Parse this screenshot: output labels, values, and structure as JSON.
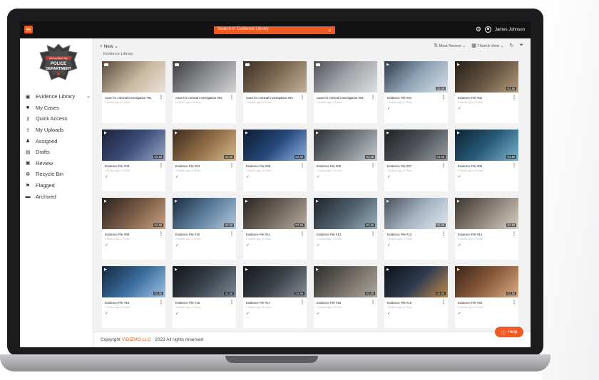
{
  "topbar": {
    "search_placeholder": "Search in Evidence Library",
    "user_name": "James Johnson"
  },
  "logo": {
    "badge_text": "Metropolitan City",
    "line1": "POLICE",
    "line2": "DEPARTMENT"
  },
  "sidebar": {
    "items": [
      {
        "label": "Evidence Library",
        "icon": "archive-icon"
      },
      {
        "label": "My Cases",
        "icon": "briefcase-icon"
      },
      {
        "label": "Quick Access",
        "icon": "key-icon"
      },
      {
        "label": "My Uploads",
        "icon": "upload-icon"
      },
      {
        "label": "Assigned",
        "icon": "assigned-user-icon"
      },
      {
        "label": "Drafts",
        "icon": "drafts-icon"
      },
      {
        "label": "Review",
        "icon": "review-icon"
      },
      {
        "label": "Recycle Bin",
        "icon": "recycle-icon"
      },
      {
        "label": "Flagged",
        "icon": "flag-icon"
      },
      {
        "label": "Archived",
        "icon": "archived-icon"
      }
    ]
  },
  "toolbar": {
    "new_label": "+ New ⌄",
    "sort_label": "Most Recent ⌄",
    "view_label": "Thumb View ⌄",
    "breadcrumb": "Evidence Library"
  },
  "cards": [
    {
      "title": "Case for criminal investigation #01",
      "sub": "1 Months ago | 0 Views",
      "duration": "",
      "kind": "case",
      "check": false
    },
    {
      "title": "Case for criminal investigation #02",
      "sub": "1 Months ago | 0 Views",
      "duration": "",
      "kind": "case",
      "check": false
    },
    {
      "title": "Case for criminal investigation #03",
      "sub": "1 Months ago | 0 Views",
      "duration": "",
      "kind": "case",
      "check": false
    },
    {
      "title": "Case for criminal investigation #04",
      "sub": "1 Months ago | 0 Views",
      "duration": "",
      "kind": "case",
      "check": false
    },
    {
      "title": "Evidence File #01",
      "sub": "1 Months ago | 0 Views",
      "duration": "01:49",
      "kind": "video",
      "check": true
    },
    {
      "title": "Evidence File #02",
      "sub": "1 Months ago | 0 Views",
      "duration": "01:49",
      "kind": "video",
      "check": true
    },
    {
      "title": "Evidence File #03",
      "sub": "1 Months ago | 0 Views",
      "duration": "01:49",
      "kind": "video",
      "check": true
    },
    {
      "title": "Evidence File #04",
      "sub": "1 Months ago | 0 Views",
      "duration": "01:49",
      "kind": "video",
      "check": true
    },
    {
      "title": "Evidence File #05",
      "sub": "1 Months ago | 0 Views",
      "duration": "01:49",
      "kind": "video",
      "check": true
    },
    {
      "title": "Evidence File #06",
      "sub": "1 Months ago | 0 Views",
      "duration": "01:49",
      "kind": "video",
      "check": true
    },
    {
      "title": "Evidence File #07",
      "sub": "1 Months ago | 0 Views",
      "duration": "01:49",
      "kind": "video",
      "check": true
    },
    {
      "title": "Evidence File #08",
      "sub": "1 Months ago | 0 Views",
      "duration": "01:49",
      "kind": "video",
      "check": true
    },
    {
      "title": "Evidence File #09",
      "sub": "1 Months ago | 0 Views",
      "duration": "01:49",
      "kind": "video",
      "check": true
    },
    {
      "title": "Evidence File #10",
      "sub": "1 Months ago | 0 Views",
      "duration": "01:49",
      "kind": "video",
      "check": true
    },
    {
      "title": "Evidence File #11",
      "sub": "1 Months ago | 0 Views",
      "duration": "01:49",
      "kind": "video",
      "check": true
    },
    {
      "title": "Evidence File #12",
      "sub": "1 Months ago | 0 Views",
      "duration": "01:49",
      "kind": "video",
      "check": true
    },
    {
      "title": "Evidence File #13",
      "sub": "1 Months ago | 0 Views",
      "duration": "01:49",
      "kind": "video",
      "check": true
    },
    {
      "title": "Evidence File #14",
      "sub": "1 Months ago | 0 Views",
      "duration": "01:49",
      "kind": "video",
      "check": true
    },
    {
      "title": "Evidence File #15",
      "sub": "1 Months ago | 0 Views",
      "duration": "01:49",
      "kind": "video",
      "check": true
    },
    {
      "title": "Evidence File #16",
      "sub": "1 Months ago | 0 Views",
      "duration": "01:49",
      "kind": "video",
      "check": true
    },
    {
      "title": "Evidence File #17",
      "sub": "1 Months ago | 0 Views",
      "duration": "01:49",
      "kind": "video",
      "check": true
    },
    {
      "title": "Evidence File #18",
      "sub": "1 Months ago | 0 Views",
      "duration": "01:49",
      "kind": "video",
      "check": true
    },
    {
      "title": "Evidence File #19",
      "sub": "1 Months ago | 0 Views",
      "duration": "01:49",
      "kind": "video",
      "check": true
    },
    {
      "title": "Evidence File #20",
      "sub": "1 Months ago | 0 Views",
      "duration": "01:49",
      "kind": "video",
      "check": true
    }
  ],
  "footer": {
    "prefix": "Copyright ",
    "brand": "VIDIZMO LLC",
    "suffix": " · 2023 All rights reserved"
  },
  "help": {
    "label": "Help"
  },
  "colors": {
    "accent": "#ef5a24",
    "topbar": "#121212",
    "background": "#f2f2f2"
  }
}
